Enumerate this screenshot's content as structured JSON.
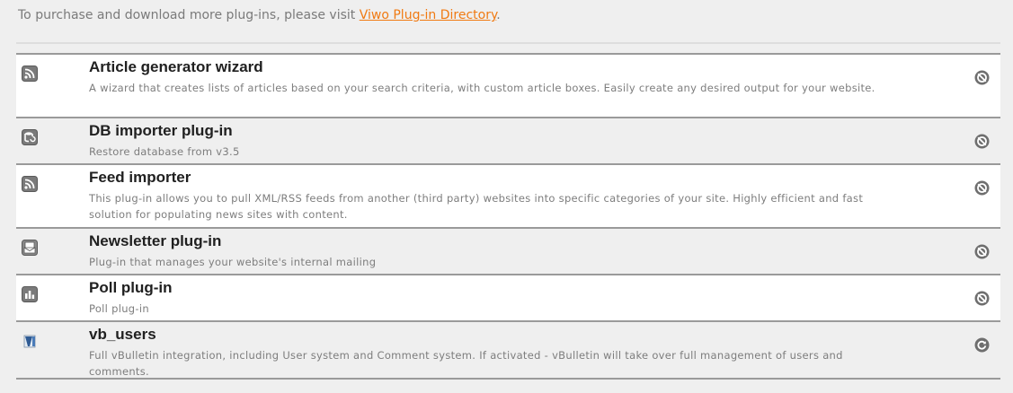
{
  "intro": {
    "text": "To purchase and download more plug-ins, please visit ",
    "link_label": "Viwo Plug-in Directory",
    "trailing": "."
  },
  "plugins": [
    {
      "name": "Article generator wizard",
      "description": "A wizard that creates lists of articles based on your search criteria, with custom article boxes. Easily create any desired output for your website.",
      "type_icon": "rss-feed-icon",
      "status_icon": "deactivated-icon"
    },
    {
      "name": "DB importer plug-in",
      "description": "Restore database from v3.5",
      "type_icon": "database-restore-icon",
      "status_icon": "deactivated-icon"
    },
    {
      "name": "Feed importer",
      "description": "This plug-in allows you to pull XML/RSS feeds from another (third party) websites into specific categories of your site. Highly efficient and fast solution for populating news sites with content.",
      "type_icon": "rss-feed-icon",
      "status_icon": "deactivated-icon"
    },
    {
      "name": "Newsletter plug-in",
      "description": "Plug-in that manages your website's internal mailing",
      "type_icon": "newsletter-icon",
      "status_icon": "deactivated-icon"
    },
    {
      "name": "Poll plug-in",
      "description": "Poll plug-in",
      "type_icon": "poll-chart-icon",
      "status_icon": "deactivated-icon"
    },
    {
      "name": "vb_users",
      "description": "Full vBulletin integration, including User system and Comment system. If activated - vBulletin will take over full management of users and comments.",
      "type_icon": "vbulletin-icon",
      "status_icon": "activate-icon"
    }
  ],
  "colors": {
    "link": "#f07a12",
    "title": "#202020",
    "description": "#7d7d7d",
    "row_alt_bg": "#efefef",
    "row_bg": "#ffffff"
  }
}
